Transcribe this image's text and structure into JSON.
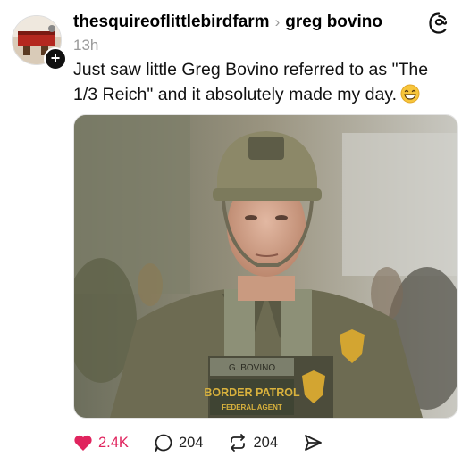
{
  "post": {
    "author": "thesquireoflittlebirdfarm",
    "recipient": "greg bovino",
    "separator": "›",
    "time": "13h",
    "text": "Just saw little Greg Bovino referred to as \"The 1/3 Reich\" and it absolutely made my day.",
    "emoji": "grinning-face-with-smiling-eyes"
  },
  "image": {
    "name_tape": "G. BOVINO",
    "patch_line1": "BORDER PATROL",
    "patch_line2": "FEDERAL AGENT"
  },
  "actions": {
    "likes": "2.4K",
    "replies": "204",
    "reposts": "204"
  },
  "colors": {
    "like": "#e0245e",
    "muted": "#9a9a9a"
  },
  "icons": [
    "threads-logo-icon",
    "plus-icon",
    "heart-icon",
    "reply-icon",
    "repost-icon",
    "share-icon"
  ]
}
